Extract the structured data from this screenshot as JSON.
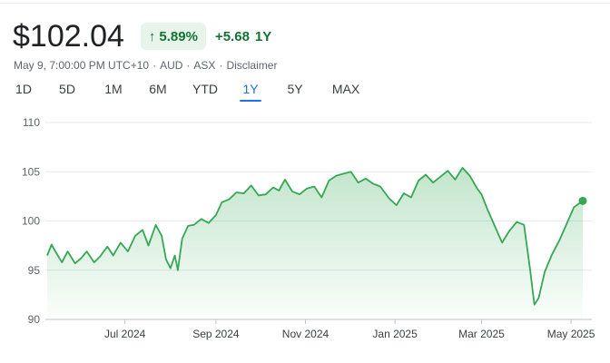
{
  "quote": {
    "price": "$102.04",
    "percent_change": "5.89%",
    "abs_change": "+5.68",
    "period": "1Y"
  },
  "meta": {
    "timestamp": "May 9, 7:00:00 PM UTC+10",
    "currency": "AUD",
    "exchange": "ASX",
    "disclaimer": "Disclaimer"
  },
  "ranges": [
    "1D",
    "5D",
    "1M",
    "6M",
    "YTD",
    "1Y",
    "5Y",
    "MAX"
  ],
  "active_range": "1Y",
  "colors": {
    "positive": "#137333",
    "line": "#34a853",
    "accent": "#1a73e8"
  },
  "chart_data": {
    "type": "area",
    "ylim": [
      90,
      110
    ],
    "yticks": [
      90,
      95,
      100,
      105,
      110
    ],
    "xticks": [
      {
        "label": "Jul 2024",
        "x": "2024-07-01"
      },
      {
        "label": "Sep 2024",
        "x": "2024-09-01"
      },
      {
        "label": "Nov 2024",
        "x": "2024-11-01"
      },
      {
        "label": "Jan 2025",
        "x": "2025-01-01"
      },
      {
        "label": "Mar 2025",
        "x": "2025-03-01"
      },
      {
        "label": "May 2025",
        "x": "2025-05-01"
      }
    ],
    "x_range": [
      "2024-05-09",
      "2025-05-09"
    ],
    "series": [
      {
        "x": [
          "2024-05-09",
          "2024-05-12",
          "2024-05-15",
          "2024-05-19",
          "2024-05-23",
          "2024-05-28",
          "2024-06-01",
          "2024-06-05",
          "2024-06-10",
          "2024-06-14",
          "2024-06-19",
          "2024-06-23",
          "2024-06-28",
          "2024-07-03",
          "2024-07-08",
          "2024-07-13",
          "2024-07-17",
          "2024-07-22",
          "2024-07-26",
          "2024-07-29",
          "2024-08-01",
          "2024-08-04",
          "2024-08-06",
          "2024-08-09",
          "2024-08-13",
          "2024-08-17",
          "2024-08-22",
          "2024-08-27",
          "2024-09-01",
          "2024-09-05",
          "2024-09-10",
          "2024-09-15",
          "2024-09-20",
          "2024-09-25",
          "2024-09-30",
          "2024-10-05",
          "2024-10-10",
          "2024-10-14",
          "2024-10-18",
          "2024-10-23",
          "2024-10-28",
          "2024-11-02",
          "2024-11-07",
          "2024-11-12",
          "2024-11-17",
          "2024-11-22",
          "2024-11-27",
          "2024-12-02",
          "2024-12-07",
          "2024-12-12",
          "2024-12-17",
          "2024-12-22",
          "2024-12-28",
          "2025-01-02",
          "2025-01-07",
          "2025-01-12",
          "2025-01-17",
          "2025-01-22",
          "2025-01-27",
          "2025-02-01",
          "2025-02-06",
          "2025-02-11",
          "2025-02-16",
          "2025-02-21",
          "2025-02-26",
          "2025-03-01",
          "2025-03-05",
          "2025-03-10",
          "2025-03-15",
          "2025-03-20",
          "2025-03-25",
          "2025-03-30",
          "2025-04-03",
          "2025-04-06",
          "2025-04-09",
          "2025-04-13",
          "2025-04-18",
          "2025-04-23",
          "2025-04-28",
          "2025-05-03",
          "2025-05-09"
        ],
        "values": [
          96.5,
          97.6,
          96.8,
          95.8,
          96.9,
          95.7,
          96.2,
          96.9,
          95.8,
          96.4,
          97.4,
          96.5,
          97.8,
          96.9,
          98.5,
          99.1,
          97.5,
          99.6,
          98.5,
          96.1,
          95.2,
          96.5,
          95.0,
          98.2,
          99.5,
          99.6,
          100.2,
          99.8,
          100.6,
          101.9,
          102.2,
          102.9,
          102.8,
          103.6,
          102.6,
          102.7,
          103.4,
          103.1,
          104.2,
          103.0,
          102.7,
          103.3,
          103.5,
          102.4,
          104.1,
          104.6,
          104.8,
          105.0,
          103.9,
          104.3,
          103.8,
          103.5,
          102.3,
          101.6,
          102.8,
          102.4,
          104.1,
          104.7,
          103.9,
          104.5,
          105.1,
          104.2,
          105.4,
          104.6,
          103.3,
          102.7,
          101.2,
          99.5,
          97.8,
          99.0,
          99.9,
          99.6,
          95.2,
          91.5,
          92.2,
          94.8,
          96.6,
          98.0,
          99.7,
          101.4,
          102.04
        ]
      }
    ],
    "last_point": {
      "x": "2025-05-09",
      "y": 102.04
    }
  }
}
